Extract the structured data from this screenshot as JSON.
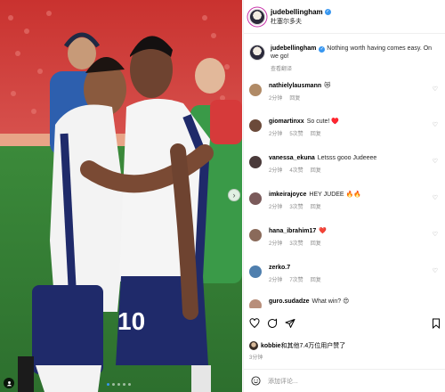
{
  "post": {
    "username": "judebellingham",
    "location": "杜塞尔多夫",
    "caption": "Nothing worth having comes easy. On we go!",
    "caption_meta": "查看翻译",
    "image_alt": "Two England footballers embracing on the pitch",
    "jersey_number": "10"
  },
  "comments": [
    {
      "user": "nathielylausmann",
      "text": "😻",
      "time": "2分钟",
      "likes": "",
      "reply": "回复",
      "avatar_color": "#b08a66"
    },
    {
      "user": "giomartinxx",
      "text": "So cute! ♥️",
      "time": "2分钟",
      "likes": "5次赞",
      "reply": "回复",
      "avatar_color": "#6b4a3a"
    },
    {
      "user": "vanessa_ekuna",
      "text": "Letsss gooo Judeeee",
      "time": "2分钟",
      "likes": "4次赞",
      "reply": "回复",
      "avatar_color": "#4a3a3a"
    },
    {
      "user": "imkeirajoyce",
      "text": "HEY JUDEE 🔥🔥",
      "time": "2分钟",
      "likes": "3次赞",
      "reply": "回复",
      "avatar_color": "#7a5a5a"
    },
    {
      "user": "hana_ibrahim17",
      "text": "❤️",
      "time": "2分钟",
      "likes": "3次赞",
      "reply": "回复",
      "avatar_color": "#8a6a5a"
    },
    {
      "user": "zerko.7",
      "text": "",
      "time": "2分钟",
      "likes": "7次赞",
      "reply": "回复",
      "avatar_color": "#4f7fae"
    },
    {
      "user": "guro.sudadze",
      "text": "What win? 😍",
      "time": "",
      "likes": "",
      "reply": "",
      "avatar_color": "#b88e7a"
    }
  ],
  "likes_line": {
    "user": "kobbie",
    "rest": "和其他7.4万位用户赞了"
  },
  "post_time": "3分钟",
  "add_comment_placeholder": "添加评论...",
  "carousel": {
    "count": 5,
    "active": 0
  }
}
